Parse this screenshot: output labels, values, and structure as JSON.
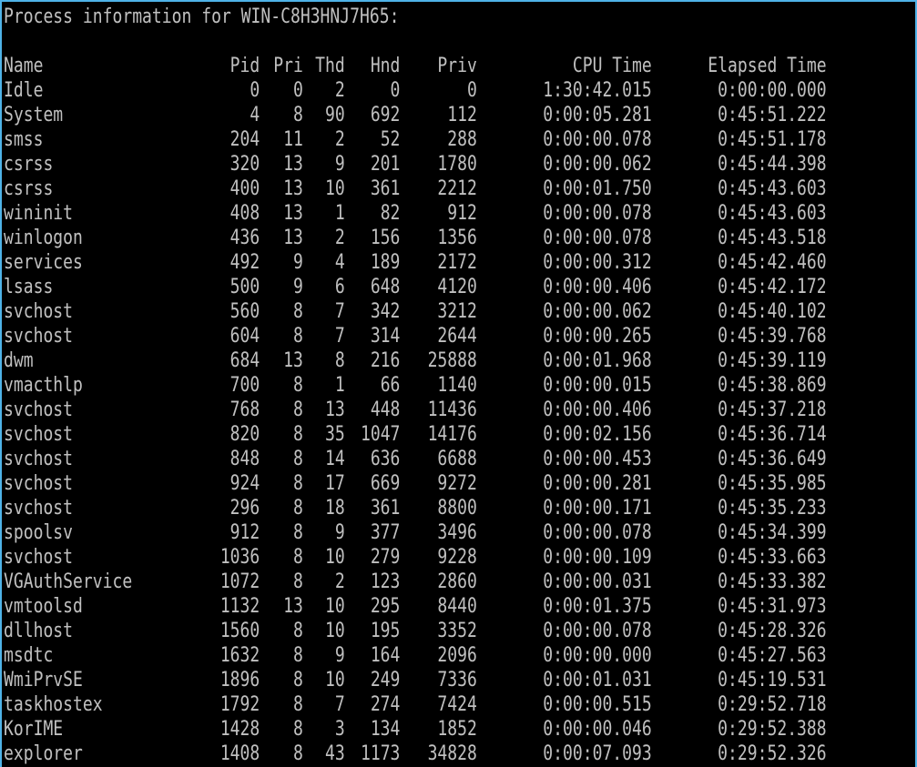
{
  "window": {
    "border_color": "#4fb3e8",
    "background": "#000000",
    "text_color": "#c0c0c0"
  },
  "title": "Process information for WIN-C8H3HNJ7H65:",
  "table": {
    "headers": {
      "name": "Name",
      "pid": "Pid",
      "pri": "Pri",
      "thd": "Thd",
      "hnd": "Hnd",
      "priv": "Priv",
      "cpu": "CPU Time",
      "elapsed": "Elapsed Time"
    },
    "rows": [
      {
        "name": "Idle",
        "pid": "0",
        "pri": "0",
        "thd": "2",
        "hnd": "0",
        "priv": "0",
        "cpu": "1:30:42.015",
        "elapsed": "0:00:00.000"
      },
      {
        "name": "System",
        "pid": "4",
        "pri": "8",
        "thd": "90",
        "hnd": "692",
        "priv": "112",
        "cpu": "0:00:05.281",
        "elapsed": "0:45:51.222"
      },
      {
        "name": "smss",
        "pid": "204",
        "pri": "11",
        "thd": "2",
        "hnd": "52",
        "priv": "288",
        "cpu": "0:00:00.078",
        "elapsed": "0:45:51.178"
      },
      {
        "name": "csrss",
        "pid": "320",
        "pri": "13",
        "thd": "9",
        "hnd": "201",
        "priv": "1780",
        "cpu": "0:00:00.062",
        "elapsed": "0:45:44.398"
      },
      {
        "name": "csrss",
        "pid": "400",
        "pri": "13",
        "thd": "10",
        "hnd": "361",
        "priv": "2212",
        "cpu": "0:00:01.750",
        "elapsed": "0:45:43.603"
      },
      {
        "name": "wininit",
        "pid": "408",
        "pri": "13",
        "thd": "1",
        "hnd": "82",
        "priv": "912",
        "cpu": "0:00:00.078",
        "elapsed": "0:45:43.603"
      },
      {
        "name": "winlogon",
        "pid": "436",
        "pri": "13",
        "thd": "2",
        "hnd": "156",
        "priv": "1356",
        "cpu": "0:00:00.078",
        "elapsed": "0:45:43.518"
      },
      {
        "name": "services",
        "pid": "492",
        "pri": "9",
        "thd": "4",
        "hnd": "189",
        "priv": "2172",
        "cpu": "0:00:00.312",
        "elapsed": "0:45:42.460"
      },
      {
        "name": "lsass",
        "pid": "500",
        "pri": "9",
        "thd": "6",
        "hnd": "648",
        "priv": "4120",
        "cpu": "0:00:00.406",
        "elapsed": "0:45:42.172"
      },
      {
        "name": "svchost",
        "pid": "560",
        "pri": "8",
        "thd": "7",
        "hnd": "342",
        "priv": "3212",
        "cpu": "0:00:00.062",
        "elapsed": "0:45:40.102"
      },
      {
        "name": "svchost",
        "pid": "604",
        "pri": "8",
        "thd": "7",
        "hnd": "314",
        "priv": "2644",
        "cpu": "0:00:00.265",
        "elapsed": "0:45:39.768"
      },
      {
        "name": "dwm",
        "pid": "684",
        "pri": "13",
        "thd": "8",
        "hnd": "216",
        "priv": "25888",
        "cpu": "0:00:01.968",
        "elapsed": "0:45:39.119"
      },
      {
        "name": "vmacthlp",
        "pid": "700",
        "pri": "8",
        "thd": "1",
        "hnd": "66",
        "priv": "1140",
        "cpu": "0:00:00.015",
        "elapsed": "0:45:38.869"
      },
      {
        "name": "svchost",
        "pid": "768",
        "pri": "8",
        "thd": "13",
        "hnd": "448",
        "priv": "11436",
        "cpu": "0:00:00.406",
        "elapsed": "0:45:37.218"
      },
      {
        "name": "svchost",
        "pid": "820",
        "pri": "8",
        "thd": "35",
        "hnd": "1047",
        "priv": "14176",
        "cpu": "0:00:02.156",
        "elapsed": "0:45:36.714"
      },
      {
        "name": "svchost",
        "pid": "848",
        "pri": "8",
        "thd": "14",
        "hnd": "636",
        "priv": "6688",
        "cpu": "0:00:00.453",
        "elapsed": "0:45:36.649"
      },
      {
        "name": "svchost",
        "pid": "924",
        "pri": "8",
        "thd": "17",
        "hnd": "669",
        "priv": "9272",
        "cpu": "0:00:00.281",
        "elapsed": "0:45:35.985"
      },
      {
        "name": "svchost",
        "pid": "296",
        "pri": "8",
        "thd": "18",
        "hnd": "361",
        "priv": "8800",
        "cpu": "0:00:00.171",
        "elapsed": "0:45:35.233"
      },
      {
        "name": "spoolsv",
        "pid": "912",
        "pri": "8",
        "thd": "9",
        "hnd": "377",
        "priv": "3496",
        "cpu": "0:00:00.078",
        "elapsed": "0:45:34.399"
      },
      {
        "name": "svchost",
        "pid": "1036",
        "pri": "8",
        "thd": "10",
        "hnd": "279",
        "priv": "9228",
        "cpu": "0:00:00.109",
        "elapsed": "0:45:33.663"
      },
      {
        "name": "VGAuthService",
        "pid": "1072",
        "pri": "8",
        "thd": "2",
        "hnd": "123",
        "priv": "2860",
        "cpu": "0:00:00.031",
        "elapsed": "0:45:33.382"
      },
      {
        "name": "vmtoolsd",
        "pid": "1132",
        "pri": "13",
        "thd": "10",
        "hnd": "295",
        "priv": "8440",
        "cpu": "0:00:01.375",
        "elapsed": "0:45:31.973"
      },
      {
        "name": "dllhost",
        "pid": "1560",
        "pri": "8",
        "thd": "10",
        "hnd": "195",
        "priv": "3352",
        "cpu": "0:00:00.078",
        "elapsed": "0:45:28.326"
      },
      {
        "name": "msdtc",
        "pid": "1632",
        "pri": "8",
        "thd": "9",
        "hnd": "164",
        "priv": "2096",
        "cpu": "0:00:00.000",
        "elapsed": "0:45:27.563"
      },
      {
        "name": "WmiPrvSE",
        "pid": "1896",
        "pri": "8",
        "thd": "10",
        "hnd": "249",
        "priv": "7336",
        "cpu": "0:00:01.031",
        "elapsed": "0:45:19.531"
      },
      {
        "name": "taskhostex",
        "pid": "1792",
        "pri": "8",
        "thd": "7",
        "hnd": "274",
        "priv": "7424",
        "cpu": "0:00:00.515",
        "elapsed": "0:29:52.718"
      },
      {
        "name": "KorIME",
        "pid": "1428",
        "pri": "8",
        "thd": "3",
        "hnd": "134",
        "priv": "1852",
        "cpu": "0:00:00.046",
        "elapsed": "0:29:52.388"
      },
      {
        "name": "explorer",
        "pid": "1408",
        "pri": "8",
        "thd": "43",
        "hnd": "1173",
        "priv": "34828",
        "cpu": "0:00:07.093",
        "elapsed": "0:29:52.326"
      }
    ]
  }
}
